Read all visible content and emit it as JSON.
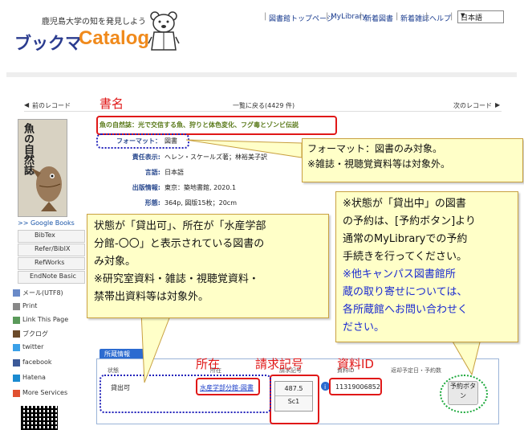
{
  "header": {
    "tagline": "鹿児島大学の知を発見しよう",
    "logo_kana": "ブックマ",
    "logo_catalog": "Catalog",
    "nav": [
      "図書館トップページ",
      "MyLibrary",
      "新着図書",
      "新着雑誌",
      "ヘルプ"
    ],
    "language": "日本語"
  },
  "record_nav": {
    "prev": "前のレコード",
    "back": "一覧に戻る(4429 件)",
    "next": "次のレコード"
  },
  "book": {
    "cover_title": "魚の自然誌",
    "title": "魚の自然誌：光で交信する魚、狩りと体色変化、フグ毒とゾンビ伝説",
    "format_label": "フォーマット：",
    "format_value": "図書",
    "fields": [
      {
        "label": "責任表示:",
        "value": "ヘレン・スケールズ著；林裕美子訳"
      },
      {
        "label": "言語:",
        "value": "日本語"
      },
      {
        "label": "出版情報:",
        "value": "東京：築地書館, 2020.1"
      },
      {
        "label": "形態:",
        "value": "364p, 図版15枚；20cm"
      }
    ]
  },
  "sidebar": {
    "google": ">> Google Books",
    "export_buttons": [
      "BibTex",
      "Refer/BibIX",
      "RefWorks",
      "EndNote Basic"
    ],
    "items": [
      "メール(UTF8)",
      "Print",
      "Link This Page",
      "ブクログ",
      "twitter",
      "facebook",
      "Hatena",
      "More Services"
    ]
  },
  "holdings": {
    "tab": "所蔵情報",
    "headers": [
      "状態",
      "所在",
      "請求記号",
      "資料ID",
      "返却予定日・予約数"
    ],
    "status": "貸出可",
    "location": "水産学部分館-図書",
    "call_number_1": "487.5",
    "call_number_2": "Sc1",
    "item_id": "11319006852",
    "reserve_button": "予約ボタン"
  },
  "annotations": {
    "title_label": "書名",
    "location_label": "所在",
    "callno_label": "請求記号",
    "itemid_label": "資料ID",
    "callout_format": [
      "フォーマット：図書のみ対象。",
      "※雑誌・視聴覚資料等は対象外。"
    ],
    "callout_status": [
      "状態が「貸出可」、所在が「水産学部",
      "分館-〇〇」と表示されている図書の",
      "み対象。",
      "※研究室資料・雑誌・視聴覚資料・",
      "禁帯出資料等は対象外。"
    ],
    "callout_reserve_black": [
      "※状態が「貸出中」の図書",
      "の予約は、[予約ボタン]より",
      "通常のMyLibraryでの予約",
      "手続きを行ってください。"
    ],
    "callout_reserve_blue": [
      "※他キャンパス図書館所",
      "蔵の取り寄せについては、",
      "各所蔵館へお問い合わせく",
      "ださい。"
    ]
  },
  "colors": {
    "accent_red": "#e01818",
    "logo_blue": "#2b3c8f",
    "logo_orange": "#f08a1c",
    "callout_fill": "#ffffc8",
    "link_blue": "#1a55a8"
  }
}
